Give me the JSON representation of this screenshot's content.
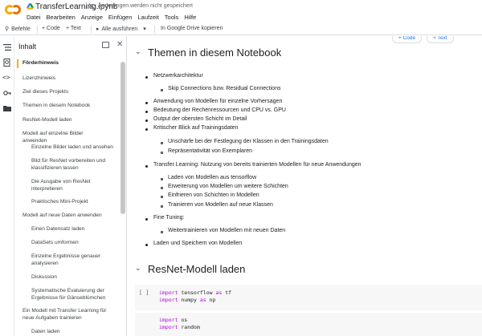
{
  "header": {
    "title": "TransferLearning.ipynb",
    "save_status": "Änderungen werden nicht gespeichert",
    "menu": [
      "Datei",
      "Bearbeiten",
      "Anzeige",
      "Einfügen",
      "Laufzeit",
      "Tools",
      "Hilfe"
    ]
  },
  "toolbar": {
    "commands": "Befehle",
    "add_code": "+ Code",
    "add_text": "+ Text",
    "run_all": "Alle ausführen",
    "copy_drive": "In Google Drive kopieren"
  },
  "sidebar": {
    "title": "Inhalt",
    "items": [
      {
        "label": "Förderhinweis",
        "level": 0,
        "active": true
      },
      {
        "label": "Lizenzhinweis",
        "level": 0
      },
      {
        "label": "Ziel dieses Projekts",
        "level": 0
      },
      {
        "label": "Themen in diesem Notebook",
        "level": 0
      },
      {
        "label": "ResNet-Modell laden",
        "level": 0
      },
      {
        "label": "Modell auf einzelne Bilder anwenden",
        "level": 0
      },
      {
        "label": "Einzelne Bilder laden und ansehen",
        "level": 1
      },
      {
        "label": "Bild für ResNet vorbereiten und klassifizieren lassen",
        "level": 1
      },
      {
        "label": "Die Ausgabe von ResNet interpretieren",
        "level": 1
      },
      {
        "label": "Praktisches Mini-Projekt",
        "level": 1
      },
      {
        "label": "Modell auf neue Daten anwenden",
        "level": 0
      },
      {
        "label": "Einen Datensatz laden",
        "level": 1
      },
      {
        "label": "DataSets umformen",
        "level": 1
      },
      {
        "label": "Einzelne Ergebnisse genauer analysieren",
        "level": 1
      },
      {
        "label": "Diskussion",
        "level": 1
      },
      {
        "label": "Systematische Evaluierung der Ergebnisse für Gänseblümchen",
        "level": 1
      },
      {
        "label": "Ein Modell mit Transfer Learning für neue Aufgaben trainieren",
        "level": 0
      },
      {
        "label": "Daten laden",
        "level": 1
      }
    ]
  },
  "cell_actions": {
    "code": "+ Code",
    "text": "+ Text"
  },
  "section1": {
    "heading": "Themen in diesem Notebook",
    "items": [
      {
        "text": "Netzwerkarchitektur",
        "level": 0
      },
      {
        "text": "Skip Connections bzw. Residual Connections",
        "level": 1
      },
      {
        "text": "Anwendung von Modellen für einzelne Vorhersagen",
        "level": 0
      },
      {
        "text": "Bedeutung der Rechenressourcen und CPU vs. GPU",
        "level": 0
      },
      {
        "text": "Output der obersten Schicht im Detail",
        "level": 0
      },
      {
        "text": "Kritischer Blick auf Trainingsdaten",
        "level": 0
      },
      {
        "text": "Unschärfe bei der Festlegung der Klassen in den Trainingsdaten",
        "level": 1
      },
      {
        "text": "Repräsentativität von Exemplaren",
        "level": 1
      },
      {
        "text": "Transfer Learning: Nutzung von bereits trainierten Modellen für neue Anwendungen",
        "level": 0
      },
      {
        "text": "Laden von Modellen aus tensorflow",
        "level": 1
      },
      {
        "text": "Erweiterung von Modellen um weitere Schichten",
        "level": 1
      },
      {
        "text": "Einfrieren von Schichten in Modellen",
        "level": 1
      },
      {
        "text": "Trainieren von Modellen auf neue Klassen",
        "level": 1
      },
      {
        "text": "Fine Tuning:",
        "level": 0
      },
      {
        "text": "Weitertrainieren von Modellen mit neuen Daten",
        "level": 1
      },
      {
        "text": "Laden und Speichern von Modellen",
        "level": 0
      }
    ]
  },
  "section2": {
    "heading": "ResNet-Modell laden",
    "cell1": {
      "run": "[ ]",
      "line1_kw": "import",
      "line1_mod": " tensorflow ",
      "line1_as": "as",
      "line1_alias": " tf",
      "line2_kw": "import",
      "line2_mod": " numpy ",
      "line2_as": "as",
      "line2_alias": " np"
    },
    "cell2": {
      "line1_kw": "import",
      "line1_mod": " os",
      "line2_kw": "import",
      "line2_mod": " random"
    }
  }
}
